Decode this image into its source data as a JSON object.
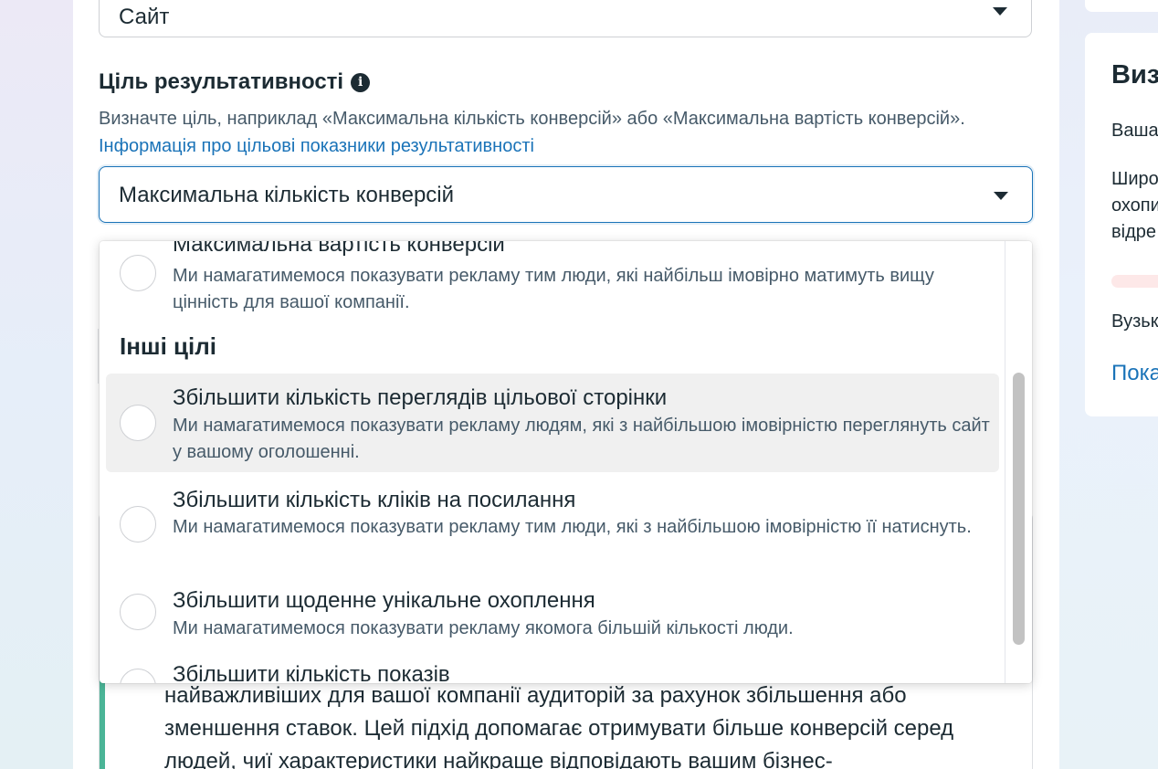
{
  "top_select": {
    "value": "Сайт"
  },
  "performance_goal": {
    "title": "Ціль результативності",
    "description": "Визначте ціль, наприклад «Максимальна кількість конверсій» або «Максимальна вартість конверсій». ",
    "link_text": "Інформація про цільові показники результативності",
    "selected_value": "Максимальна кількість конверсій"
  },
  "dropdown": {
    "first_option": {
      "title": "Максимальна вартість конверсій",
      "description": "Ми намагатимемося показувати рекламу тим люди, які найбільш імовірно матимуть вищу цінність для вашої компанії."
    },
    "group_label": "Інші цілі",
    "options": [
      {
        "title": "Збільшити кількість переглядів цільової сторінки",
        "description": "Ми намагатимемося показувати рекламу людям, які з найбільшою імовірністю переглянуть сайт у вашому оголошенні."
      },
      {
        "title": "Збільшити кількість кліків на посилання",
        "description": "Ми намагатимемося показувати рекламу тим люди, які з найбільшою імовірністю її натиснуть."
      },
      {
        "title": "Збільшити щоденне унікальне охоплення",
        "description": "Ми намагатимемося показувати рекламу якомога більшій кількості люди."
      },
      {
        "title": "Збільшити кількість показів",
        "description": ""
      }
    ]
  },
  "underlying_text": "найважливіших для вашої компанії аудиторій за рахунок збільшення або зменшення ставок. Цей підхід допомагає отримувати більше конверсій серед людей, чиї характеристики найкраще відповідають вашим бізнес-",
  "right_panel": {
    "title": "Виз",
    "line1": "Ваша",
    "line2a": "Широ",
    "line2b": "охопи",
    "line2c": "відре",
    "line3": "Вузьк",
    "link": "Пока"
  },
  "colors": {
    "accent": "#1a73b8",
    "text": "#1c2b33",
    "secondary_text": "#465a69",
    "hover_bg": "#f0f0f0",
    "green_bar": "#4bb597"
  }
}
